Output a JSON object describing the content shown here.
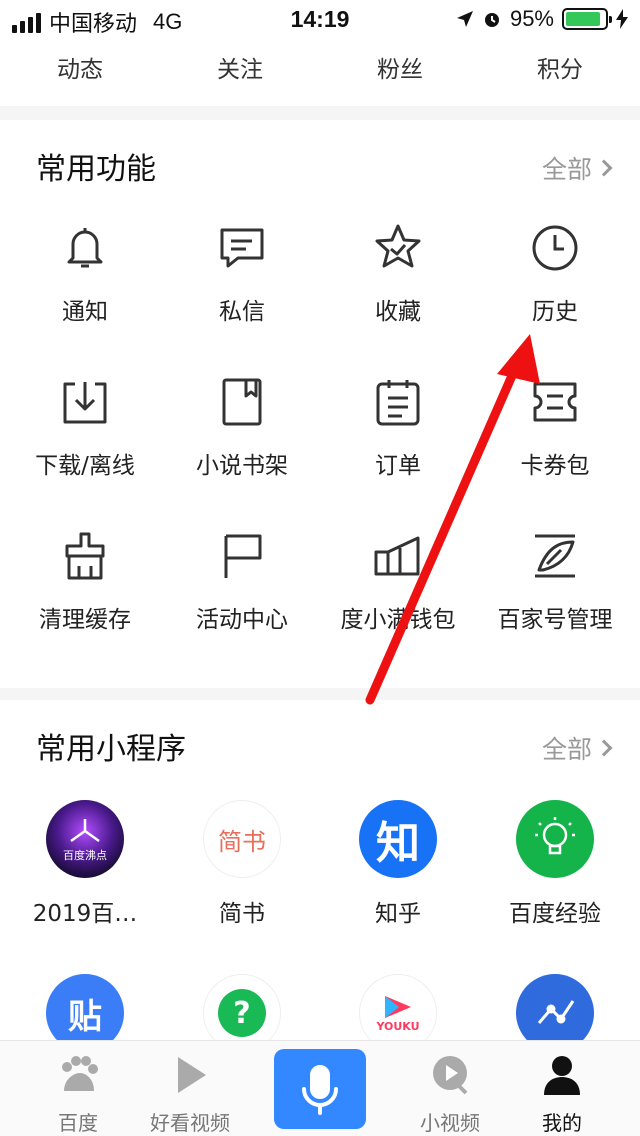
{
  "status_bar": {
    "carrier": "中国移动",
    "network": "4G",
    "time": "14:19",
    "battery": "95%"
  },
  "stats": [
    {
      "label": "动态"
    },
    {
      "label": "关注"
    },
    {
      "label": "粉丝"
    },
    {
      "label": "积分"
    }
  ],
  "functions": {
    "title": "常用功能",
    "all_label": "全部",
    "items": [
      {
        "label": "通知",
        "icon": "bell-icon"
      },
      {
        "label": "私信",
        "icon": "message-icon"
      },
      {
        "label": "收藏",
        "icon": "star-icon"
      },
      {
        "label": "历史",
        "icon": "clock-icon"
      },
      {
        "label": "下载/离线",
        "icon": "download-icon"
      },
      {
        "label": "小说书架",
        "icon": "book-icon"
      },
      {
        "label": "订单",
        "icon": "order-icon"
      },
      {
        "label": "卡券包",
        "icon": "ticket-icon"
      },
      {
        "label": "清理缓存",
        "icon": "brush-icon"
      },
      {
        "label": "活动中心",
        "icon": "flag-icon"
      },
      {
        "label": "度小满钱包",
        "icon": "wallet-icon"
      },
      {
        "label": "百家号管理",
        "icon": "edit-icon"
      }
    ]
  },
  "mini_programs": {
    "title": "常用小程序",
    "all_label": "全部",
    "items": [
      {
        "label": "2019百…",
        "badge": "百度沸点"
      },
      {
        "label": "简书",
        "badge": "简书"
      },
      {
        "label": "知乎",
        "badge": "知"
      },
      {
        "label": "百度经验",
        "badge": ""
      }
    ],
    "row2": [
      {
        "badge": "贴"
      },
      {
        "badge": "?"
      },
      {
        "badge": "YOUKU"
      },
      {
        "badge": ""
      }
    ]
  },
  "tabbar": {
    "items": [
      {
        "label": "百度"
      },
      {
        "label": "好看视频"
      },
      {
        "label": ""
      },
      {
        "label": "小视频"
      },
      {
        "label": "我的"
      }
    ]
  },
  "colors": {
    "accent": "#3388ff",
    "annotation": "#ee1111"
  }
}
